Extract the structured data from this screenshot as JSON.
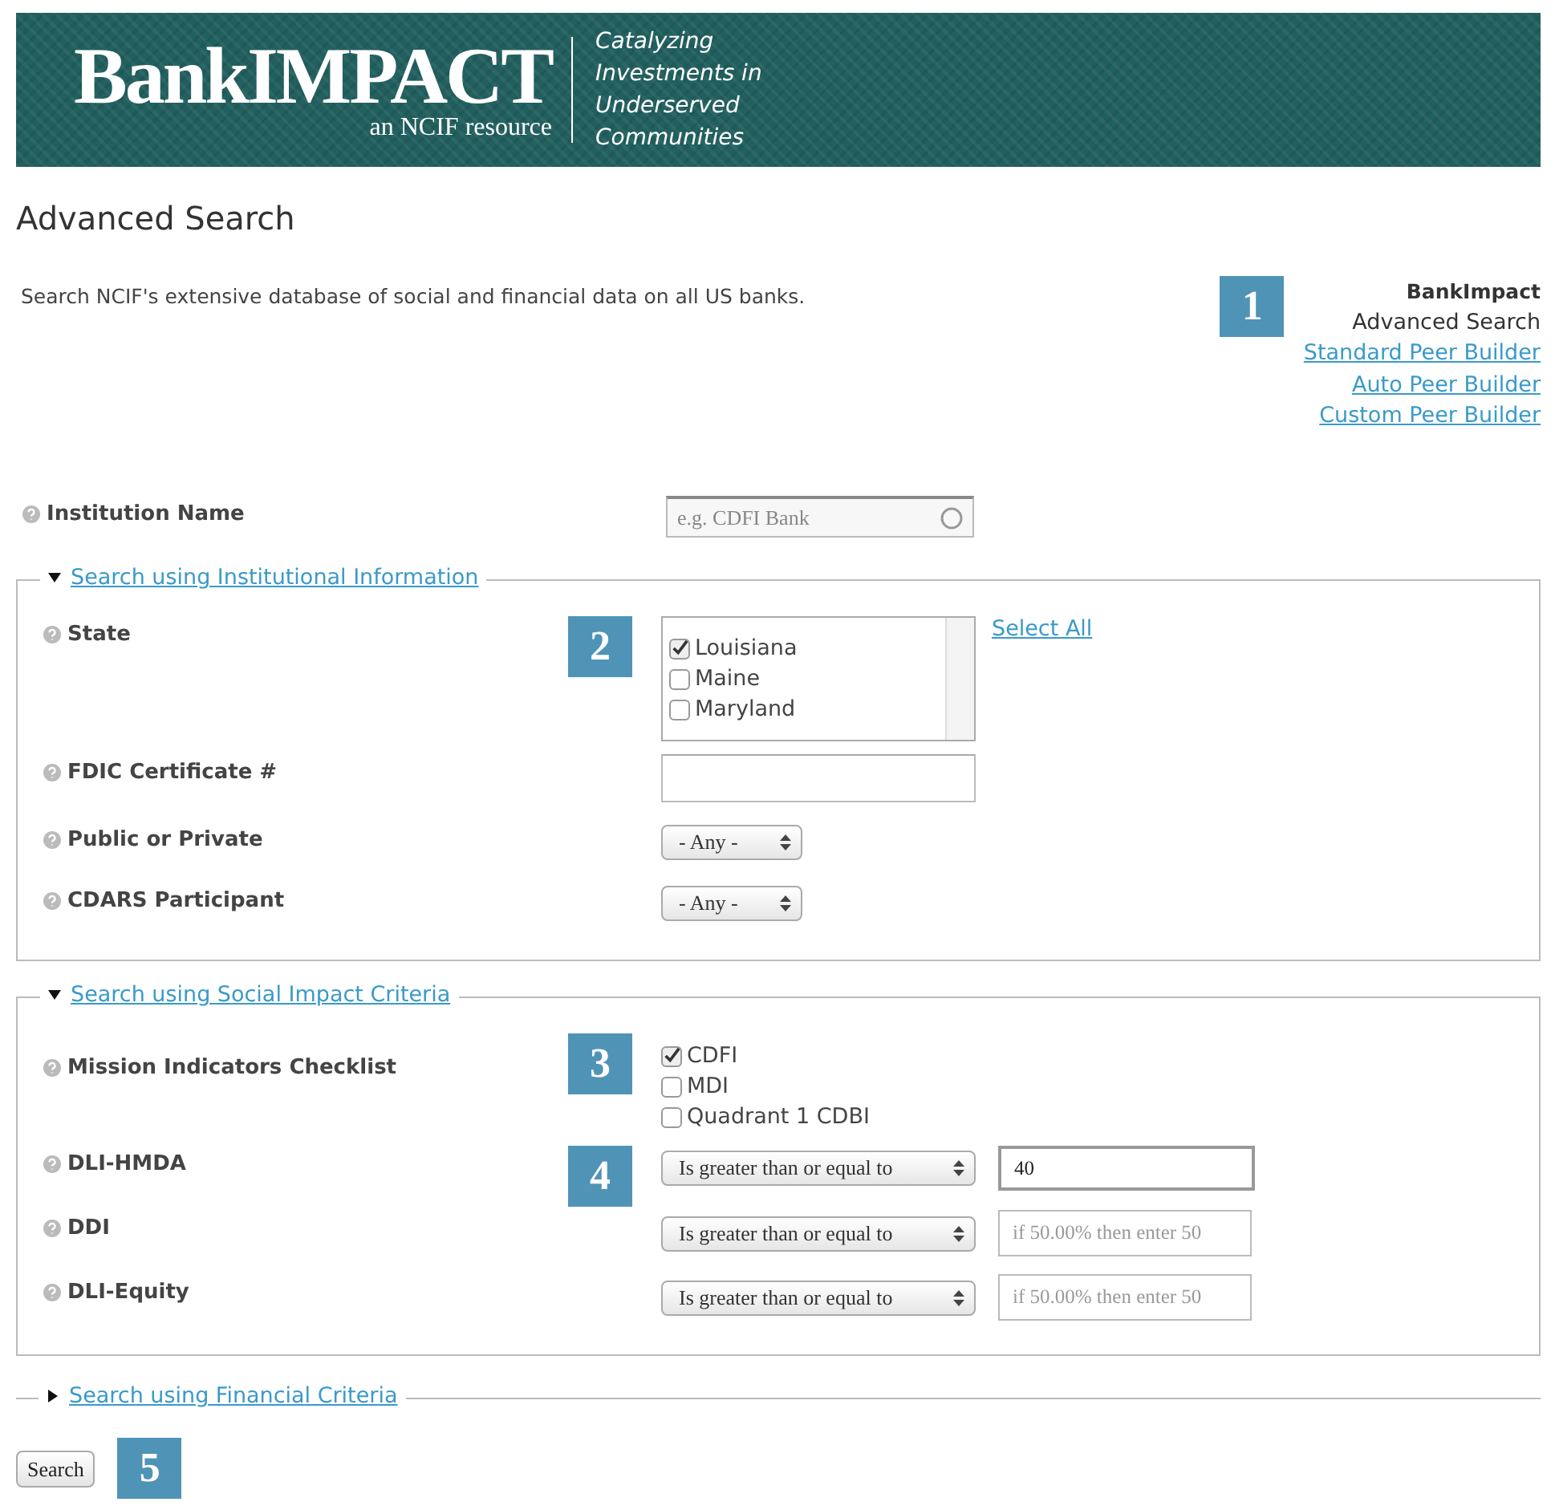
{
  "header": {
    "logo": "BankIMPACT",
    "subtitle": "an NCIF resource",
    "tagline": [
      "Catalyzing",
      "Investments in",
      "Underserved",
      "Communities"
    ]
  },
  "title": "Advanced Search",
  "intro": "Search NCIF's extensive database of social and financial data on all US banks.",
  "nav": {
    "badge": "1",
    "heading": "BankImpact",
    "items": [
      {
        "label": "Advanced Search",
        "kind": "current"
      },
      {
        "label": "Standard Peer Builder",
        "kind": "link"
      },
      {
        "label": "Auto Peer Builder",
        "kind": "link"
      },
      {
        "label": "Custom Peer Builder",
        "kind": "link"
      }
    ]
  },
  "institution_name": {
    "label": "Institution Name",
    "placeholder": "e.g. CDFI Bank"
  },
  "sections": [
    {
      "title": "Search using Institutional Information",
      "expanded": true,
      "fields": [
        {
          "kind": "listbox",
          "label": "State",
          "badge": "2",
          "action": "Select All",
          "options": [
            {
              "label": "Louisiana",
              "checked": true
            },
            {
              "label": "Maine",
              "checked": false
            },
            {
              "label": "Maryland",
              "checked": false
            }
          ]
        },
        {
          "kind": "text",
          "label": "FDIC Certificate #"
        },
        {
          "kind": "select",
          "label": "Public or Private",
          "value": "- Any -"
        },
        {
          "kind": "select",
          "label": "CDARS Participant",
          "value": "- Any -"
        }
      ]
    },
    {
      "title": "Search using Social Impact Criteria",
      "expanded": true,
      "fields": [
        {
          "kind": "checklist",
          "label": "Mission Indicators Checklist",
          "badge": "3",
          "options": [
            {
              "label": "CDFI",
              "checked": true
            },
            {
              "label": "MDI",
              "checked": false
            },
            {
              "label": "Quadrant 1 CDBI",
              "checked": false
            }
          ]
        },
        {
          "kind": "compare",
          "label": "DLI-HMDA",
          "badge": "4",
          "operator": "Is greater than or equal to",
          "value": "40"
        },
        {
          "kind": "compare",
          "label": "DDI",
          "operator": "Is greater than or equal to",
          "placeholder": "if 50.00% then enter 50"
        },
        {
          "kind": "compare",
          "label": "DLI-Equity",
          "operator": "Is greater than or equal to",
          "placeholder": "if 50.00% then enter 50"
        }
      ]
    },
    {
      "title": "Search using Financial Criteria",
      "expanded": false
    }
  ],
  "search_button": {
    "label": "Search",
    "badge": "5"
  }
}
